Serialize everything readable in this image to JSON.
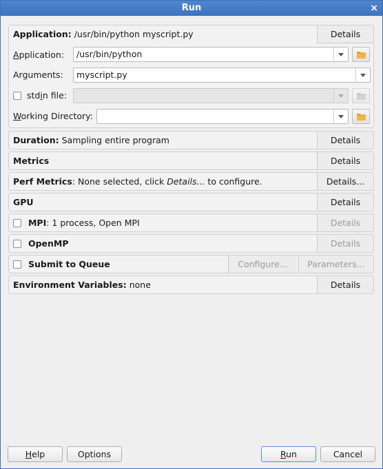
{
  "window": {
    "title": "Run",
    "close": "×"
  },
  "application_section": {
    "header_label": "Application:",
    "header_value": "/usr/bin/python myscript.py",
    "details_button": "Details",
    "application_label_pre": "",
    "application_label_u": "A",
    "application_label_post": "pplication:",
    "application_value": "/usr/bin/python",
    "arguments_label_pre": "Ar",
    "arguments_label_u": "g",
    "arguments_label_post": "uments:",
    "arguments_value": "myscript.py",
    "stdin_label_pre": "std",
    "stdin_label_u": "i",
    "stdin_label_post": "n file:",
    "stdin_value": "",
    "workdir_label_pre": "",
    "workdir_label_u": "W",
    "workdir_label_post": "orking Directory:",
    "workdir_value": ""
  },
  "duration": {
    "label": "Duration:",
    "value": "Sampling entire program",
    "button": "Details"
  },
  "metrics": {
    "label": "Metrics",
    "button": "Details"
  },
  "perf_metrics": {
    "label": "Perf Metrics",
    "value_pre": ": None selected, click ",
    "value_em": "Details...",
    "value_post": " to configure.",
    "button": "Details..."
  },
  "gpu": {
    "label": "GPU",
    "button": "Details"
  },
  "mpi": {
    "label": "MPI",
    "value": ": 1 process, Open MPI",
    "button": "Details"
  },
  "openmp": {
    "label": "OpenMP",
    "button": "Details"
  },
  "queue": {
    "label": "Submit to Queue",
    "configure_button": "Configure...",
    "parameters_button": "Parameters..."
  },
  "env_vars": {
    "label": "Environment Variables:",
    "value": "none",
    "button": "Details"
  },
  "footer": {
    "help_u": "H",
    "help_rest": "elp",
    "options": "Options",
    "run_u": "R",
    "run_rest": "un",
    "cancel": "Cancel"
  },
  "colors": {
    "titlebar": "#3f73be",
    "folder_icon": "#e8a030"
  }
}
